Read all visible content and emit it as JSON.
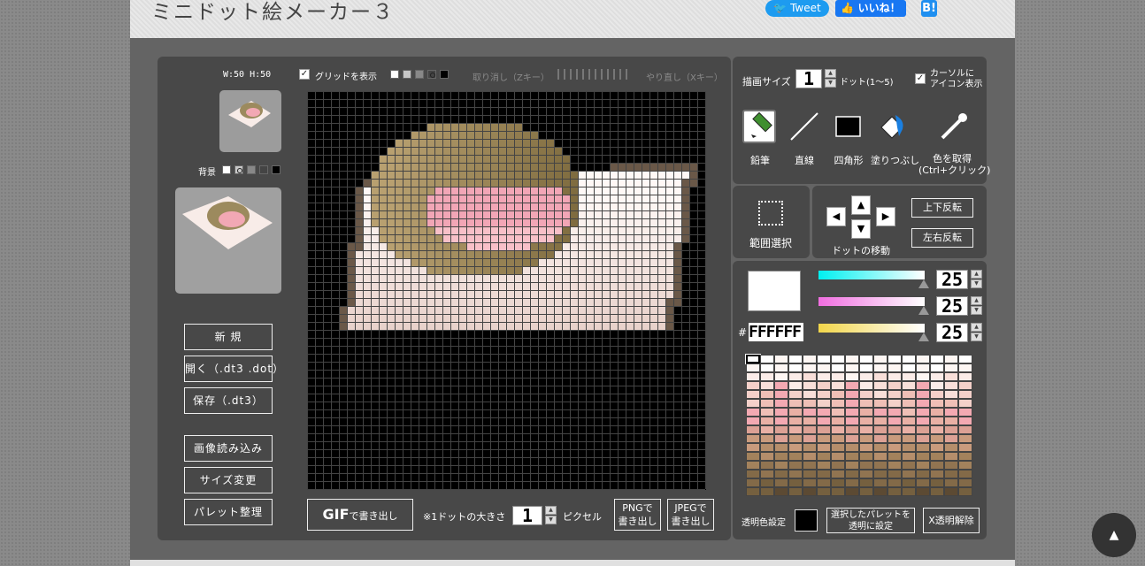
{
  "header": {
    "title": "ミニドット絵メーカー３",
    "tweet_label": "Tweet",
    "like_label": "いいね！",
    "hatena_label": "B!"
  },
  "left": {
    "size_label": "W:50 H:50",
    "grid_label": "グリッドを表示",
    "grid_colors": [
      "#ffffff",
      "#c8c8c8",
      "#888888",
      "#444444",
      "#000000"
    ],
    "undo_label": "取り消し（Zキー）",
    "redo_label": "やり直し（Xキー）",
    "bg_label": "背景",
    "bg_colors": [
      "#ffffff",
      "#c8c8c8",
      "#888888",
      "#444444",
      "#000000"
    ],
    "buttons": {
      "new": "新 規",
      "open": "開く（.dt3 .dot）",
      "save": "保存（.dt3）",
      "import": "画像読み込み",
      "resize": "サイズ変更",
      "palette": "パレット整理"
    }
  },
  "export": {
    "gif_big": "GIF",
    "gif_small": "で書き出し",
    "dot_size_label": "※1ドットの大きさ",
    "dot_size": "1",
    "pixel_label": "ピクセル",
    "png_line1": "PNGで",
    "png_line2": "書き出し",
    "jpeg_line1": "JPEGで",
    "jpeg_line2": "書き出し"
  },
  "tools": {
    "brush_label": "描画サイズ",
    "brush_size": "1",
    "dot_range": "ドット(1〜5)",
    "cursor_line1": "カーソルに",
    "cursor_line2": "アイコン表示",
    "pencil": "鉛筆",
    "line": "直線",
    "rect": "四角形",
    "fill": "塗りつぶし",
    "picker_line1": "色を取得",
    "picker_line2": "(Ctrl+クリック)"
  },
  "selection": {
    "label": "範囲選択"
  },
  "move": {
    "label": "ドットの移動",
    "flip_v": "上下反転",
    "flip_h": "左右反転",
    "up": "▲",
    "down": "▼",
    "left": "◀",
    "right": "▶"
  },
  "color": {
    "current": "#ffffff",
    "r": "25",
    "g": "25",
    "b": "25",
    "hash": "#",
    "hex": "FFFFFF",
    "transparent_label": "透明色設定",
    "set_transparent": "選択したパレットを透明に設定",
    "clear_transparent": "X透明解除"
  },
  "palette_colors": [
    "#ffffff",
    "#fdf6f3",
    "#fbece8",
    "#f8dfd9",
    "#f4d0c9",
    "#efbfb6",
    "#f3a9b2",
    "#e9b0a5",
    "#dca195",
    "#c99b7d",
    "#b58e6b",
    "#a3825c",
    "#917451",
    "#836a48",
    "#75603f",
    "#5c4a33"
  ],
  "back_to_top": "▲"
}
